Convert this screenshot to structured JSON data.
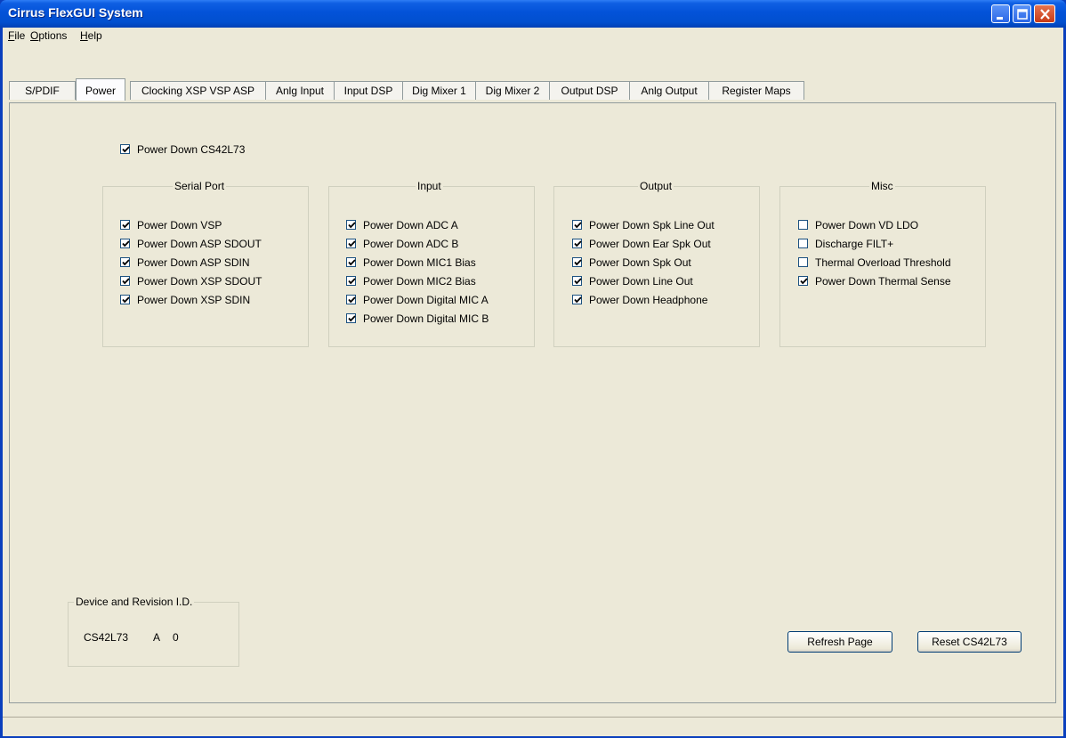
{
  "window": {
    "title": "Cirrus FlexGUI System"
  },
  "menu": [
    {
      "underline": "F",
      "rest": "ile"
    },
    {
      "underline": "O",
      "rest": "ptions"
    },
    {
      "underline": "H",
      "rest": "elp"
    }
  ],
  "tabs": [
    "S/PDIF",
    "Power",
    "Clocking XSP VSP ASP",
    "Anlg Input",
    "Input DSP",
    "Dig Mixer 1",
    "Dig Mixer 2",
    "Output DSP",
    "Anlg Output",
    "Register Maps"
  ],
  "active_tab": "Power",
  "power_down_main": {
    "label": "Power Down CS42L73",
    "checked": true
  },
  "groups": [
    {
      "title": "Serial Port",
      "items": [
        {
          "label": "Power Down VSP",
          "checked": true
        },
        {
          "label": "Power Down ASP SDOUT",
          "checked": true
        },
        {
          "label": "Power Down ASP SDIN",
          "checked": true
        },
        {
          "label": "Power Down XSP SDOUT",
          "checked": true
        },
        {
          "label": "Power Down XSP SDIN",
          "checked": true
        }
      ]
    },
    {
      "title": "Input",
      "items": [
        {
          "label": "Power Down ADC A",
          "checked": true
        },
        {
          "label": "Power Down ADC B",
          "checked": true
        },
        {
          "label": "Power Down MIC1 Bias",
          "checked": true
        },
        {
          "label": "Power Down MIC2 Bias",
          "checked": true
        },
        {
          "label": "Power Down Digital MIC A",
          "checked": true
        },
        {
          "label": "Power Down Digital MIC B",
          "checked": true
        }
      ]
    },
    {
      "title": "Output",
      "items": [
        {
          "label": "Power Down Spk Line Out",
          "checked": true
        },
        {
          "label": "Power Down Ear Spk Out",
          "checked": true
        },
        {
          "label": "Power Down Spk Out",
          "checked": true
        },
        {
          "label": "Power Down Line Out",
          "checked": true
        },
        {
          "label": "Power Down Headphone",
          "checked": true
        }
      ]
    },
    {
      "title": "Misc",
      "items": [
        {
          "label": "Power Down VD LDO",
          "checked": false
        },
        {
          "label": "Discharge FILT+",
          "checked": false
        },
        {
          "label": "Thermal Overload Threshold",
          "checked": false
        },
        {
          "label": "Power Down Thermal Sense",
          "checked": true
        }
      ]
    }
  ],
  "device": {
    "title": "Device and Revision I.D.",
    "id": "CS42L73",
    "rev_letter": "A",
    "rev_num": "0"
  },
  "buttons": {
    "refresh": "Refresh Page",
    "reset": "Reset CS42L73"
  }
}
